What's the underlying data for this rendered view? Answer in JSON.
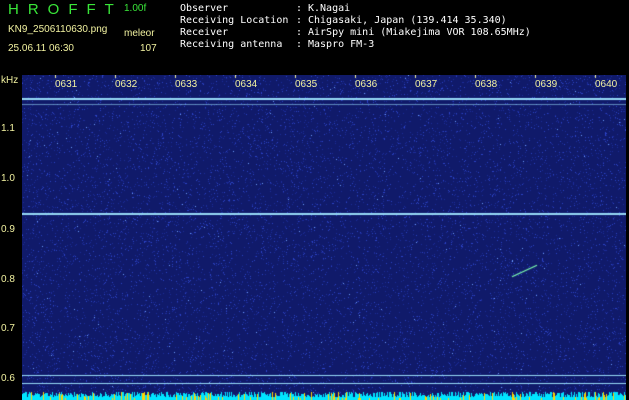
{
  "header": {
    "app_name": "HROFFT",
    "version": "1.00f",
    "filename": "KN9_2506110630.png",
    "mode_label": "meleor",
    "datetime": "25.06.11 06:30",
    "count": "107"
  },
  "metadata": [
    {
      "key": "Observer",
      "value": "K.Nagai"
    },
    {
      "key": "Receiving Location",
      "value": "Chigasaki, Japan (139.414 35.340)"
    },
    {
      "key": "Receiver",
      "value": "AirSpy mini (Miakejima VOR 108.65MHz)"
    },
    {
      "key": "Receiving antenna",
      "value": "Maspro FM-3"
    }
  ],
  "spectrogram": {
    "y_unit": "kHz",
    "y_ticks": [
      "1.1",
      "1.0",
      "0.9",
      "0.8",
      "0.7",
      "0.6"
    ],
    "x_ticks": [
      "0631",
      "0632",
      "0633",
      "0634",
      "0635",
      "0636",
      "0637",
      "0638",
      "0639",
      "0640"
    ],
    "ylim": [
      0.59,
      1.14
    ],
    "carrier_lines_khz": [
      1.1,
      1.09,
      0.9,
      0.62,
      0.605
    ],
    "background_color": "#101a6a",
    "noise_color": "#2c44c8",
    "line_color": "#9fe6ff",
    "label_color": "#f2f2a0",
    "bottom_bar_colors": [
      "#00e5ff",
      "#ffd400"
    ]
  }
}
